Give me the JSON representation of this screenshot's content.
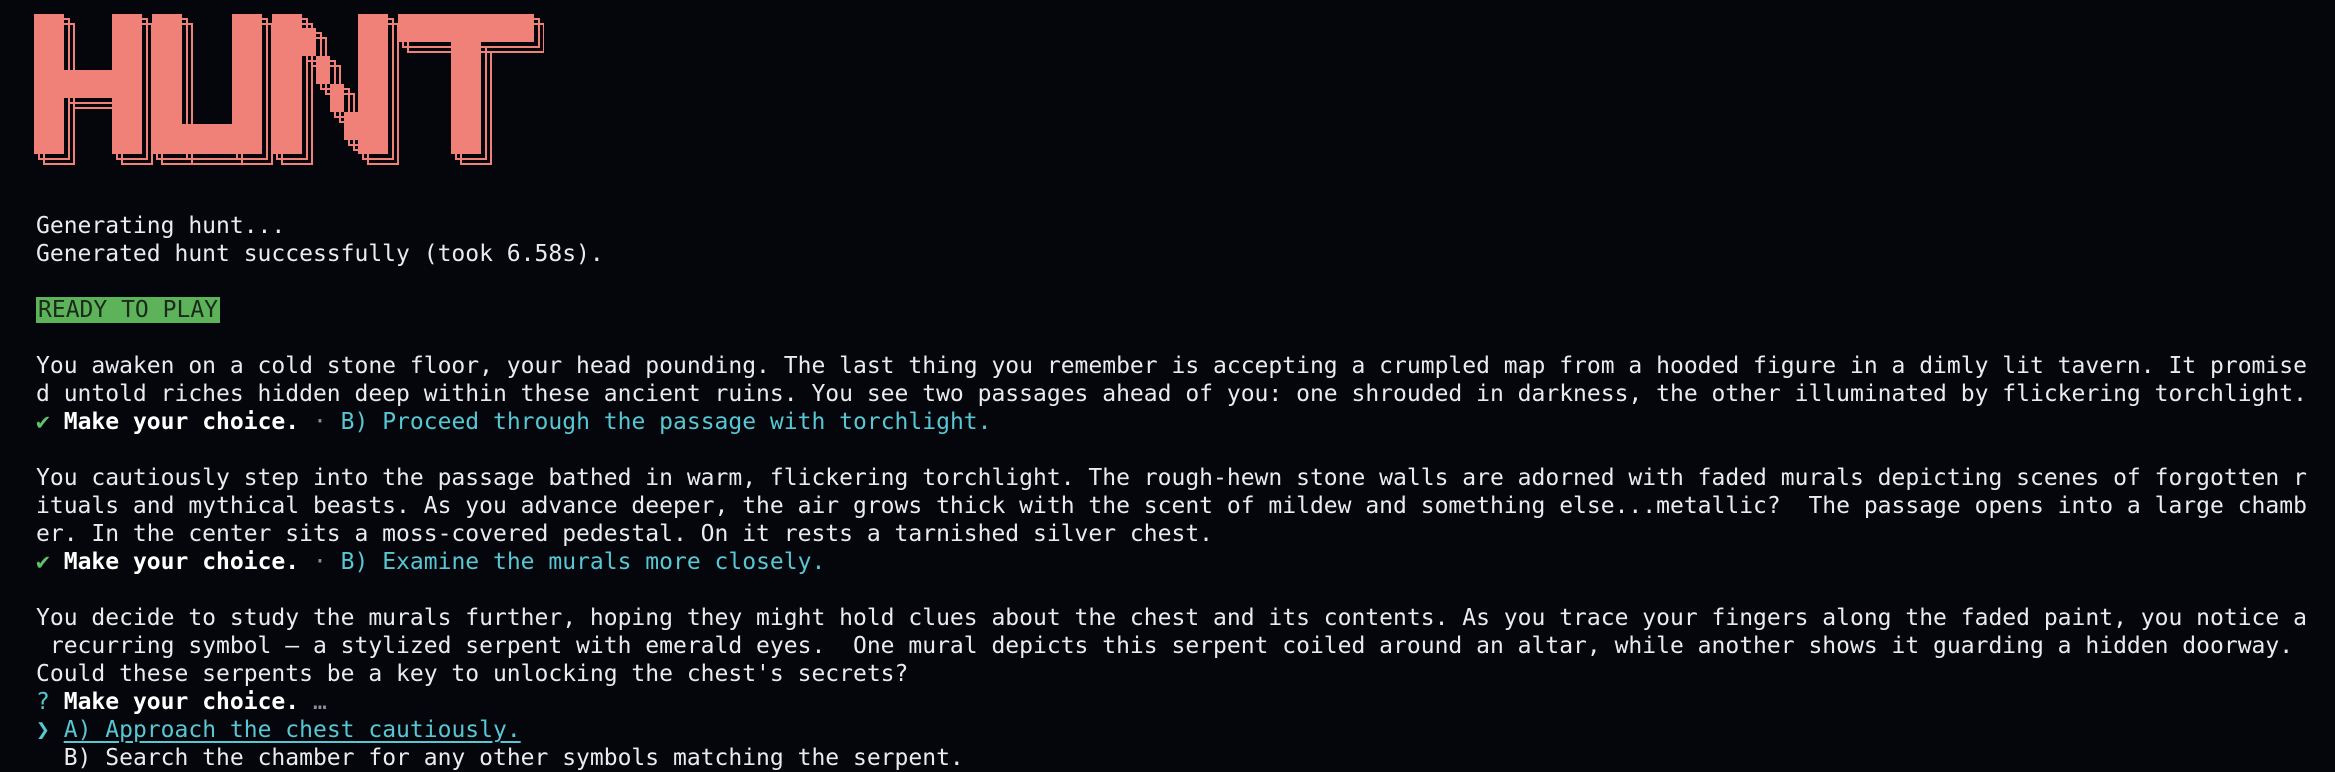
{
  "logo": {
    "text": "HUNT",
    "color": "#f08178"
  },
  "status": {
    "generating": "Generating hunt...",
    "generated": "Generated hunt successfully (took 6.58s).",
    "badge": "READY TO PLAY"
  },
  "story": [
    {
      "lines": [
        "You awaken on a cold stone floor, your head pounding. The last thing you remember is accepting a crumpled map from a hooded figure in a dimly lit tavern. It promise",
        "d untold riches hidden deep within these ancient ruins. You see two passages ahead of you: one shrouded in darkness, the other illuminated by flickering torchlight."
      ],
      "check": "✔",
      "prompt": "Make your choice.",
      "sep": " · ",
      "answer": "B) Proceed through the passage with torchlight."
    },
    {
      "lines": [
        "You cautiously step into the passage bathed in warm, flickering torchlight. The rough-hewn stone walls are adorned with faded murals depicting scenes of forgotten r",
        "ituals and mythical beasts. As you advance deeper, the air grows thick with the scent of mildew and something else...metallic?  The passage opens into a large chamb",
        "er. In the center sits a moss-covered pedestal. On it rests a tarnished silver chest."
      ],
      "check": "✔",
      "prompt": "Make your choice.",
      "sep": " · ",
      "answer": "B) Examine the murals more closely."
    },
    {
      "lines": [
        "You decide to study the murals further, hoping they might hold clues about the chest and its contents. As you trace your fingers along the faded paint, you notice a",
        " recurring symbol – a stylized serpent with emerald eyes.  One mural depicts this serpent coiled around an altar, while another shows it guarding a hidden doorway.",
        "Could these serpents be a key to unlocking the chest's secrets?"
      ]
    }
  ],
  "current_prompt": {
    "mark": "?",
    "prompt": "Make your choice.",
    "ellipsis": "…",
    "pointer": "❯",
    "options": [
      "A) Approach the chest cautiously.",
      "B) Search the chamber for any other symbols matching the serpent."
    ]
  }
}
